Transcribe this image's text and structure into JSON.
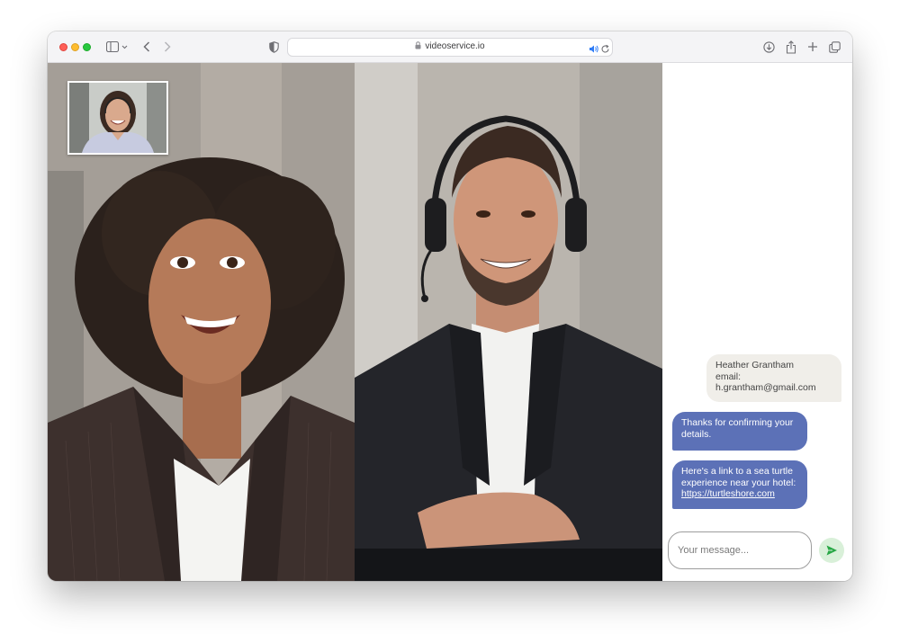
{
  "browser": {
    "url": "videoservice.io",
    "icons": {
      "sidebar": "sidebar-icon",
      "back": "chevron-left-icon",
      "forward": "chevron-right-icon",
      "privacy": "shield-icon",
      "lock": "lock-icon",
      "audio": "speaker-icon",
      "reload": "reload-icon",
      "downloads": "download-icon",
      "share": "share-icon",
      "new_tab": "plus-icon",
      "tabs": "tabs-overview-icon"
    }
  },
  "video": {
    "participants": [
      "woman-in-pinstripe-blazer",
      "man-with-headset"
    ],
    "self_view": "woman-with-headset"
  },
  "chat": {
    "messages": [
      {
        "direction": "incoming",
        "text": "Heather Grantham\nemail:\nh.grantham@gmail.com"
      },
      {
        "direction": "outgoing",
        "text": "Thanks for confirming your\ndetails."
      },
      {
        "direction": "outgoing",
        "text": "Here's a link to a sea turtle\nexperience near your hotel:",
        "link": "https://turtleshore.com"
      }
    ],
    "input_placeholder": "Your message...",
    "input_value": "",
    "colors": {
      "outgoing": "#5c71b7",
      "incoming": "#f0eee9",
      "send": "#28a745"
    }
  }
}
